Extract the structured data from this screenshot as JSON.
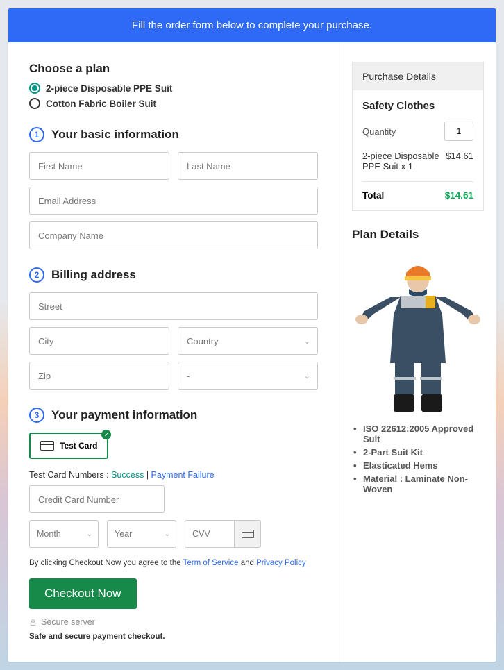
{
  "banner": "Fill the order form below to complete your purchase.",
  "plan": {
    "title": "Choose a plan",
    "options": [
      {
        "label": "2-piece Disposable PPE Suit",
        "selected": true
      },
      {
        "label": "Cotton Fabric Boiler Suit",
        "selected": false
      }
    ]
  },
  "steps": {
    "basic": {
      "num": "1",
      "title": "Your basic information"
    },
    "billing": {
      "num": "2",
      "title": "Billing address"
    },
    "payment": {
      "num": "3",
      "title": "Your payment information"
    }
  },
  "placeholders": {
    "first_name": "First Name",
    "last_name": "Last Name",
    "email": "Email Address",
    "company": "Company Name",
    "street": "Street",
    "city": "City",
    "country": "Country",
    "zip": "Zip",
    "state": "-",
    "cc_number": "Credit Card Number",
    "month": "Month",
    "year": "Year",
    "cvv": "CVV"
  },
  "payment": {
    "option_label": "Test Card",
    "hint_prefix": "Test Card Numbers : ",
    "hint_success": "Success",
    "hint_sep": " | ",
    "hint_failure": "Payment Failure"
  },
  "agree": {
    "prefix": "By clicking Checkout Now you agree to the ",
    "tos": "Term of Service",
    "mid": " and ",
    "privacy": "Privacy Policy"
  },
  "checkout_label": "Checkout Now",
  "secure_label": "Secure server",
  "safe_label": "Safe and secure payment checkout.",
  "purchase": {
    "header": "Purchase Details",
    "subtitle": "Safety Clothes",
    "qty_label": "Quantity",
    "qty_value": "1",
    "item_name": "2-piece Disposable PPE Suit x 1",
    "item_price": "$14.61",
    "total_label": "Total",
    "total_price": "$14.61"
  },
  "plan_details": {
    "title": "Plan Details",
    "bullets": [
      "ISO 22612:2005 Approved Suit",
      "2-Part Suit Kit",
      "Elasticated Hems",
      "Material : Laminate Non-Woven"
    ]
  }
}
